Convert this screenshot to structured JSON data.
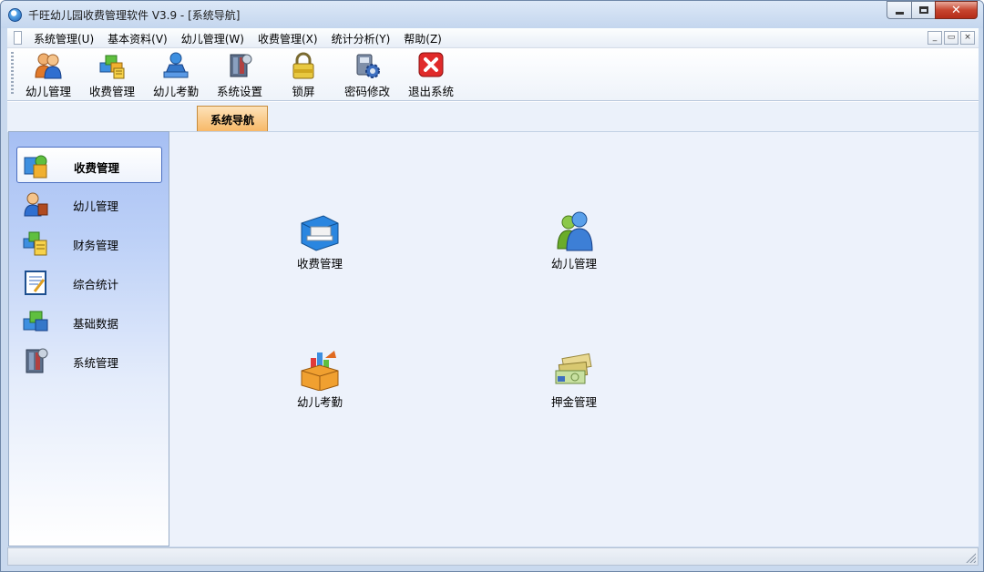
{
  "window": {
    "title": "千旺幼儿园收费管理软件 V3.9 - [系统导航]",
    "icons": {
      "app": "app-globe-icon",
      "minimize": "minimize-icon",
      "maximize": "maximize-icon",
      "close": "close-icon"
    }
  },
  "menubar": {
    "items": [
      {
        "label": "系统管理(U)"
      },
      {
        "label": "基本资料(V)"
      },
      {
        "label": "幼儿管理(W)"
      },
      {
        "label": "收费管理(X)"
      },
      {
        "label": "统计分析(Y)"
      },
      {
        "label": "帮助(Z)"
      }
    ],
    "mdi": {
      "minimize": "_",
      "restore": "▭",
      "close": "×"
    }
  },
  "toolbar": {
    "buttons": [
      {
        "label": "幼儿管理",
        "icon": "users-icon"
      },
      {
        "label": "收费管理",
        "icon": "fee-boxes-icon"
      },
      {
        "label": "幼儿考勤",
        "icon": "attendance-icon"
      },
      {
        "label": "系统设置",
        "icon": "tools-icon"
      },
      {
        "label": "锁屏",
        "icon": "lock-icon"
      },
      {
        "label": "密码修改",
        "icon": "password-gear-icon"
      },
      {
        "label": "退出系统",
        "icon": "exit-icon"
      }
    ]
  },
  "nav_tab": {
    "label": "系统导航"
  },
  "sidebar": {
    "items": [
      {
        "label": "收费管理",
        "icon": "fee-icon",
        "active": true
      },
      {
        "label": "幼儿管理",
        "icon": "child-icon"
      },
      {
        "label": "财务管理",
        "icon": "finance-icon"
      },
      {
        "label": "综合统计",
        "icon": "statistics-icon"
      },
      {
        "label": "基础数据",
        "icon": "basic-data-icon"
      },
      {
        "label": "系统管理",
        "icon": "system-tools-icon"
      }
    ]
  },
  "main": {
    "launchers": [
      {
        "label": "收费管理",
        "icon": "cash-register-icon"
      },
      {
        "label": "幼儿管理",
        "icon": "users-icon"
      },
      {
        "label": "幼儿考勤",
        "icon": "chart-box-icon"
      },
      {
        "label": "押金管理",
        "icon": "deposit-money-icon"
      }
    ]
  },
  "colors": {
    "nav_tab": "#f7b765",
    "close_button": "#c7452f",
    "sidebar_top": "#a6bff3",
    "active_border": "#4b6fc1"
  }
}
